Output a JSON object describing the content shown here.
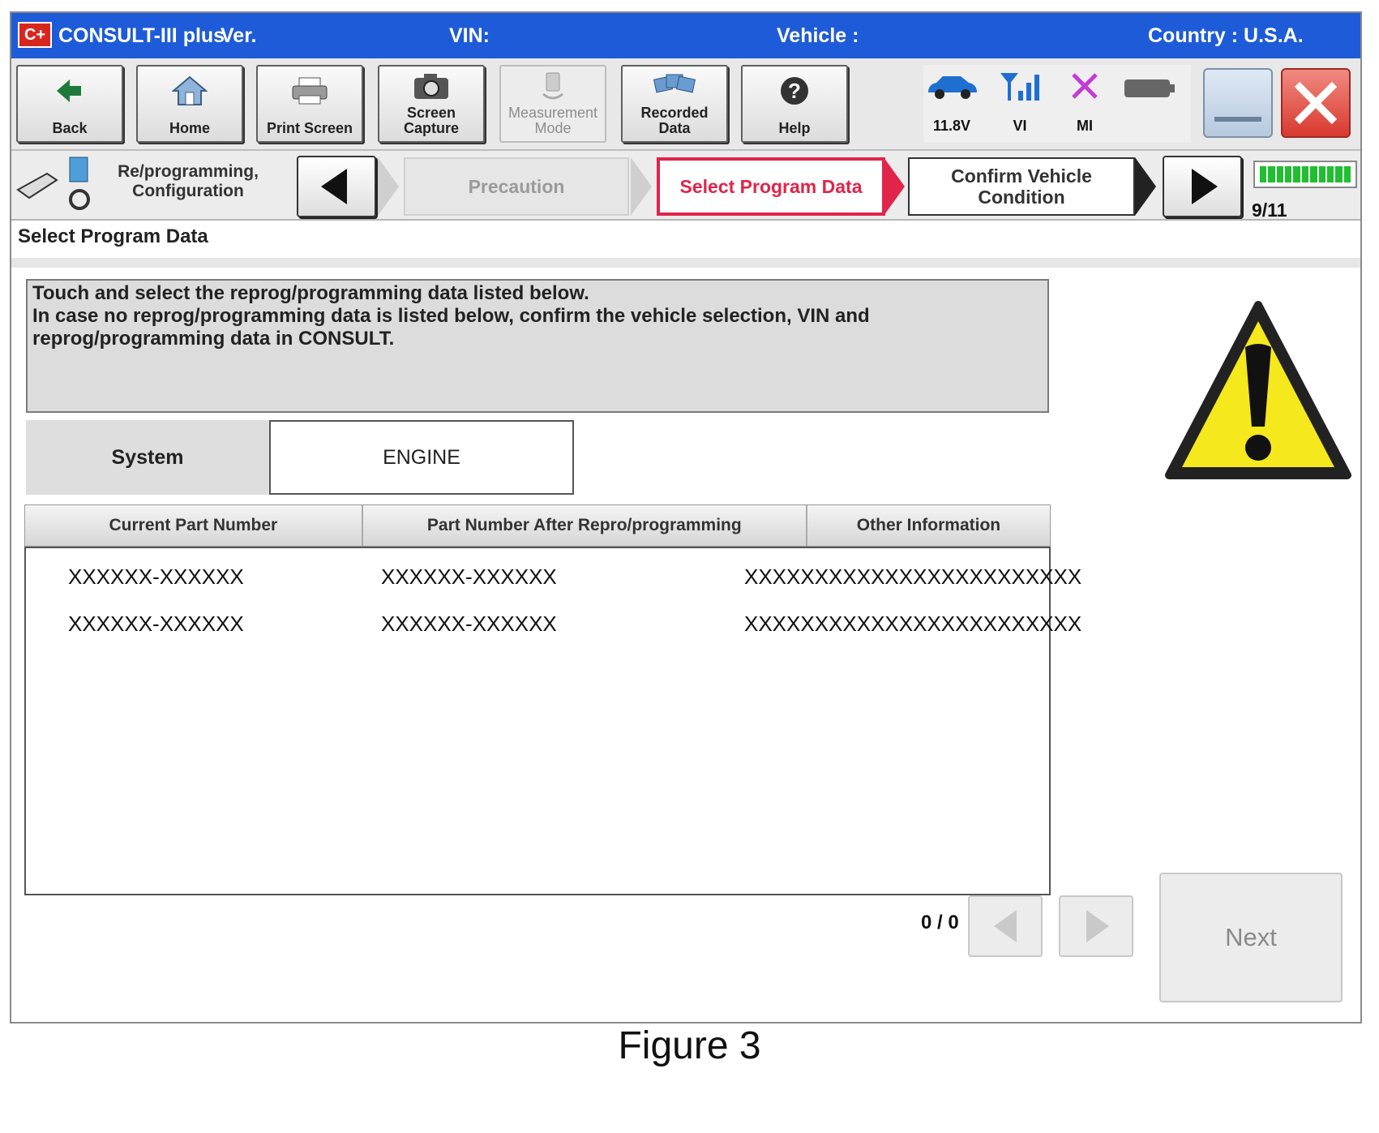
{
  "titlebar": {
    "app": "CONSULT-III plus",
    "ver_label": "Ver.",
    "vin_label": "VIN:",
    "vehicle_label": "Vehicle :",
    "country_label": "Country : U.S.A.",
    "logo_text": "C+"
  },
  "toolbar": {
    "back": "Back",
    "home": "Home",
    "print_screen": "Print Screen",
    "screen_capture": "Screen\nCapture",
    "measurement_mode": "Measurement\nMode",
    "recorded_data": "Recorded\nData",
    "help": "Help"
  },
  "status": {
    "battery": "11.8V",
    "vi": "VI",
    "mi": "MI"
  },
  "steps": {
    "section_title": "Re/programming,\nConfiguration",
    "precaution": "Precaution",
    "select_program_data": "Select Program Data",
    "confirm_vehicle_condition": "Confirm Vehicle\nCondition",
    "counter": "9/11"
  },
  "page": {
    "title": "Select Program Data",
    "message_lines": [
      "Touch and select the reprog/programming data listed below.",
      "In case no reprog/programming data is listed below, confirm the vehicle selection, VIN and",
      "reprog/programming data in CONSULT."
    ],
    "system_label": "System",
    "system_value": "ENGINE"
  },
  "table": {
    "columns": [
      "Current Part Number",
      "Part Number After Repro/programming",
      "Other Information"
    ],
    "rows": [
      [
        "XXXXXX-XXXXXX",
        "XXXXXX-XXXXXX",
        "XXXXXXXXXXXXXXXXXXXXXXXX"
      ],
      [
        "XXXXXX-XXXXXX",
        "XXXXXX-XXXXXX",
        "XXXXXXXXXXXXXXXXXXXXXXXX"
      ]
    ]
  },
  "pager": {
    "count": "0 / 0"
  },
  "next_label": "Next",
  "caption": "Figure 3",
  "colors": {
    "titlebar_bg": "#1e5bd8",
    "active_step": "#e0244a",
    "progress": "#1fbf2f"
  }
}
